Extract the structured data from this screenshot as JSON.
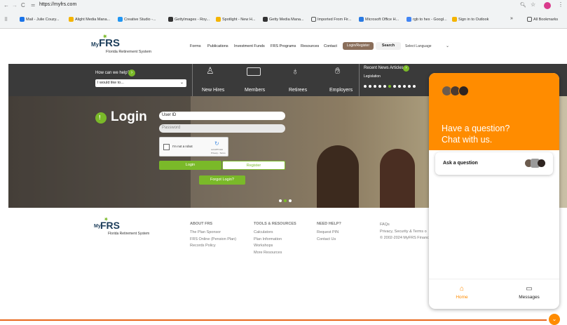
{
  "browser": {
    "url": "https://myfrs.com",
    "bookmarks": [
      "Mail - Julie Couzy...",
      "Alight Media Mana...",
      "Creative Studio -...",
      "GettyImages - Roy...",
      "Spotlight - New H...",
      "Getty Media Mana...",
      "Imported From Fir...",
      "Microsoft Office H...",
      "rgb to hex - Googl...",
      "Sign in to Outlook"
    ],
    "bookmark_colors": [
      "#1a73e8",
      "#f4b400",
      "#2196f3",
      "#333333",
      "#f4b400",
      "#333333",
      "#555555",
      "#2a7ae2",
      "#4285f4",
      "#f4b400"
    ],
    "more": "»",
    "all_bookmarks": "All Bookmarks"
  },
  "site": {
    "logo_my": "My",
    "logo_frs": "FRS",
    "logo_sub": "Florida Retirement System",
    "nav": [
      "Forms",
      "Publications",
      "Investment Funds",
      "FRS Programs",
      "Resources",
      "Contact"
    ],
    "login_register_btn": "Login/Register",
    "search_btn": "Search",
    "select_language": "Select Language",
    "help_label": "How can we help?",
    "help_select": "I would like to...",
    "audiences": [
      "New Hires",
      "Members",
      "Retirees",
      "Employers"
    ],
    "news_title": "Recent News Articles",
    "news_item": "Legislation",
    "login_title": "Login",
    "userid_placeholder": "User ID",
    "password_placeholder": "Password",
    "captcha_label": "I'm not a robot",
    "captcha_brand": "reCAPTCHA",
    "captcha_terms": "Privacy - Terms",
    "login_btn": "Login",
    "register_btn": "Register",
    "forgot_btn": "Forgot Login?",
    "footer": {
      "logo_sub": "Florida Retirement System",
      "about_title": "ABOUT FRS",
      "about_links": [
        "The Plan Sponsor",
        "FRS Online (Pension Plan)",
        "Records Policy"
      ],
      "tools_title": "TOOLS & RESOURCES",
      "tools_links": [
        "Calculators",
        "Plan Information",
        "Workshops",
        "More Resources"
      ],
      "help_title": "NEED HELP?",
      "help_links": [
        "Request PIN",
        "Contact Us"
      ],
      "faq": "FAQs",
      "privacy": "Privacy, Security & Terms o",
      "copyright": "© 2002-2024 MyFRS Financi"
    }
  },
  "chat": {
    "headline1": "Have a question?",
    "headline2": "Chat with us.",
    "ask": "Ask a question",
    "tab_home": "Home",
    "tab_messages": "Messages",
    "accent": "#ff8c00"
  },
  "colors": {
    "green": "#7ab929",
    "dark": "#3a3a3a",
    "brown": "#8a6e5a"
  }
}
